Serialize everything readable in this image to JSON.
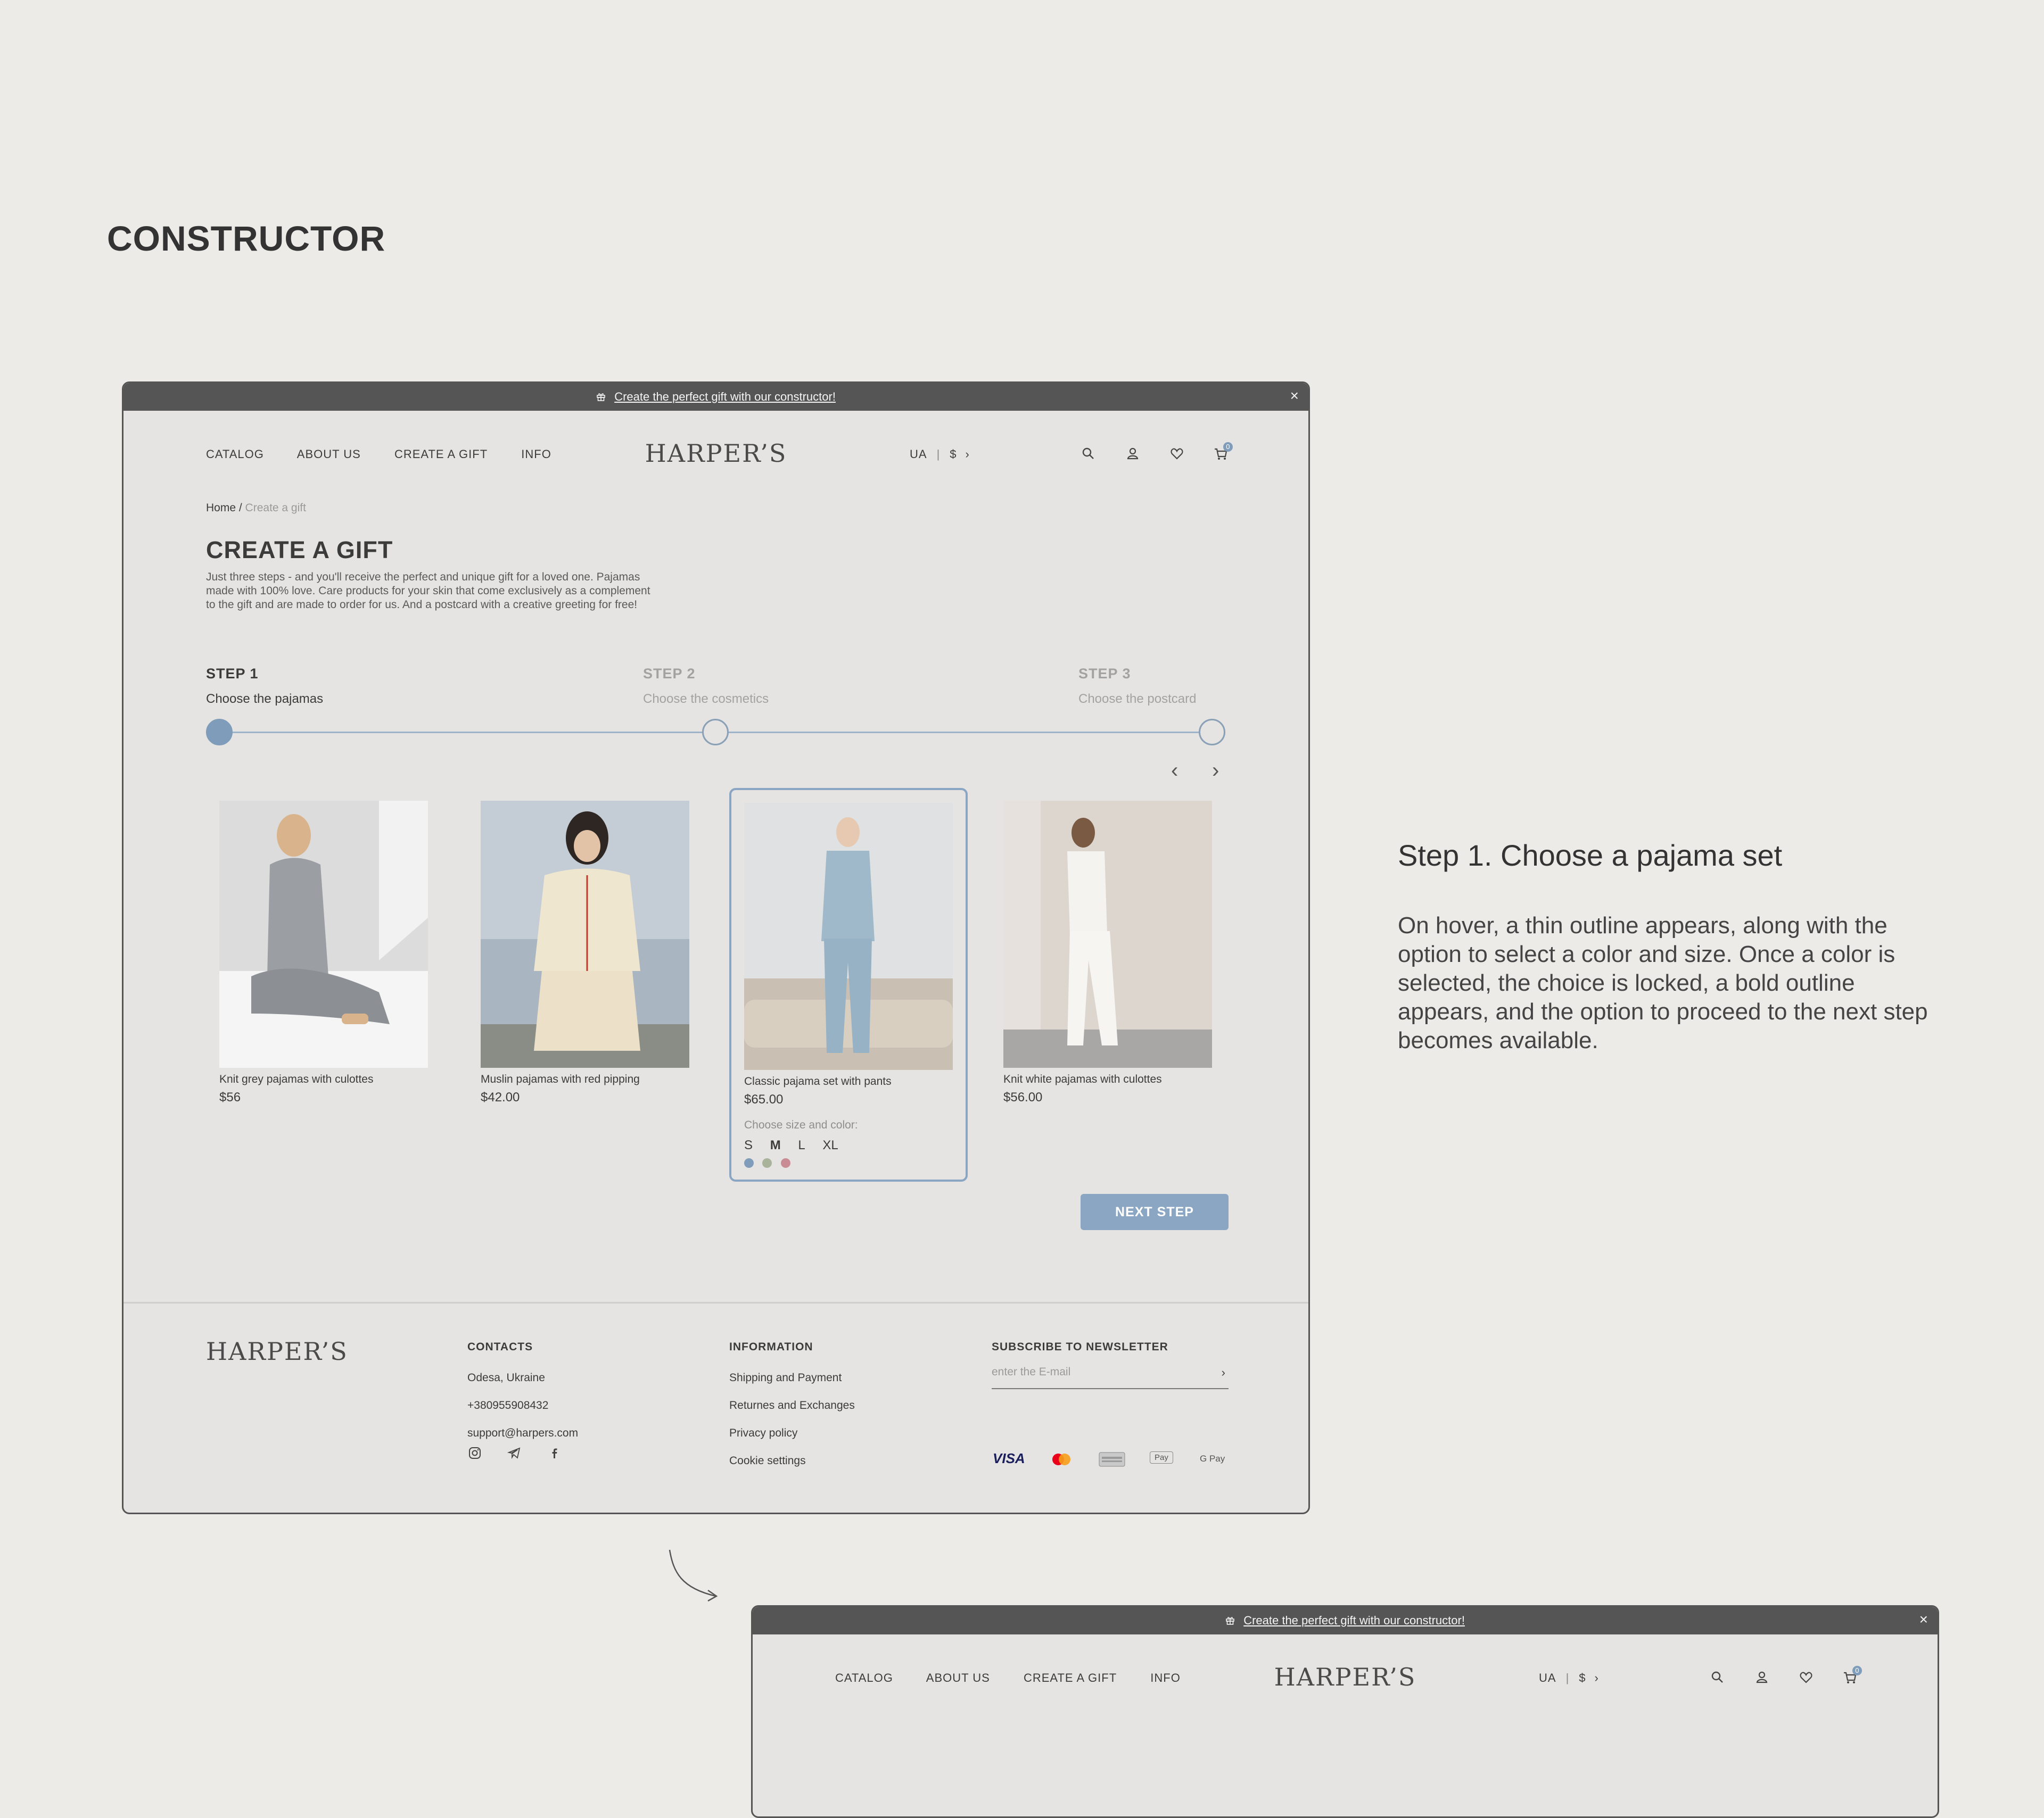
{
  "canvas_title": "CONSTRUCTOR",
  "promo": {
    "text": "Create the perfect gift with our constructor!",
    "close": "×"
  },
  "nav": {
    "links": [
      "CATALOG",
      "ABOUT US",
      "CREATE A GIFT",
      "INFO"
    ],
    "logo": "HARPER’S",
    "lang": "UA",
    "currency": "$",
    "cart_count": "0"
  },
  "breadcrumb": {
    "home": "Home",
    "sep": " / ",
    "current": "Create a gift"
  },
  "page": {
    "title": "CREATE A GIFT",
    "description_lines": [
      "Just three steps - and you'll receive the perfect and unique gift for a loved one. Pajamas",
      "made with 100% love. Care products for your skin that come exclusively as a complement",
      "to the gift and are made to order for us. And a postcard with a creative greeting for free!"
    ]
  },
  "steps": [
    {
      "label": "STEP 1",
      "desc": "Choose the pajamas"
    },
    {
      "label": "STEP 2",
      "desc": "Choose the cosmetics"
    },
    {
      "label": "STEP 3",
      "desc": "Choose the postcard"
    }
  ],
  "products": [
    {
      "name": "Knit grey pajamas with culottes",
      "price": "$56"
    },
    {
      "name": "Muslin pajamas with red pipping",
      "price": "$42.00"
    },
    {
      "name": "Classic pajama set with pants",
      "price": "$65.00",
      "choose_label": "Choose size and color:",
      "sizes": [
        "S",
        "M",
        "L",
        "XL"
      ],
      "selected_size": "M",
      "colors": [
        "#7f9cba",
        "#a9b29a",
        "#c98c94"
      ]
    },
    {
      "name": "Knit white pajamas with culottes",
      "price": "$56.00"
    }
  ],
  "next_button": "NEXT STEP",
  "footer": {
    "logo": "HARPER’S",
    "contacts": {
      "heading": "CONTACTS",
      "items": [
        "Odesa, Ukraine",
        "+380955908432",
        "support@harpers.com"
      ]
    },
    "information": {
      "heading": "INFORMATION",
      "items": [
        "Shipping and Payment",
        "Returnes and Exchanges",
        "Privacy policy",
        "Cookie settings"
      ]
    },
    "newsletter": {
      "heading": "SUBSCRIBE TO NEWSLETTER",
      "placeholder": "enter the E-mail"
    },
    "payments": {
      "visa": "VISA",
      "applepay": "Pay",
      "gpay": "G Pay"
    }
  },
  "side_note": {
    "heading": "Step 1. Choose a pajama set",
    "text": "On hover, a thin outline appears, along with the option to select a color and size. Once a color is selected, the choice is locked, a bold outline appears, and the option to proceed to the next step becomes available."
  }
}
